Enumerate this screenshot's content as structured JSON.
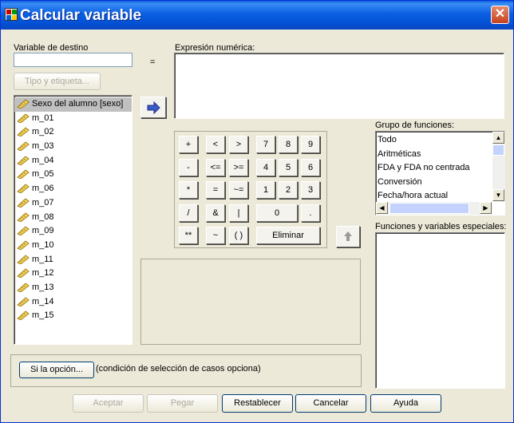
{
  "window": {
    "title": "Calcular variable",
    "close_symbol": "✕"
  },
  "target": {
    "label": "Variable de destino",
    "value": "",
    "equals": "=",
    "type_button": "Tipo y etiqueta..."
  },
  "expression": {
    "label": "Expresión numérica:",
    "value": ""
  },
  "variables": [
    "Sexo del alumno [sexo]",
    "m_01",
    "m_02",
    "m_03",
    "m_04",
    "m_05",
    "m_06",
    "m_07",
    "m_08",
    "m_09",
    "m_10",
    "m_11",
    "m_12",
    "m_13",
    "m_14",
    "m_15"
  ],
  "keypad": {
    "ops": [
      [
        "+",
        "<",
        ">"
      ],
      [
        "-",
        "<=",
        ">="
      ],
      [
        "*",
        "=",
        "~="
      ],
      [
        "/",
        "&",
        "|"
      ],
      [
        "**",
        "~",
        "( )"
      ]
    ],
    "digits": [
      [
        "7",
        "8",
        "9"
      ],
      [
        "4",
        "5",
        "6"
      ],
      [
        "1",
        "2",
        "3"
      ]
    ],
    "zero": "0",
    "dot": ".",
    "delete": "Eliminar"
  },
  "function_group": {
    "label": "Grupo de funciones:",
    "items": [
      "Todo",
      "Aritméticas",
      "FDA y FDA no centrada",
      "Conversión",
      "Fecha/hora actual"
    ]
  },
  "special": {
    "label": "Funciones y variables especiales:"
  },
  "condition": {
    "button": "Si la opción...",
    "text": "(condición de selección de casos opciona)"
  },
  "footer": {
    "ok": "Aceptar",
    "paste": "Pegar",
    "reset": "Restablecer",
    "cancel": "Cancelar",
    "help": "Ayuda"
  },
  "colors": {
    "title_bar": "#0a5fdc",
    "face": "#ece9d8",
    "selection": "#c0c0c0"
  }
}
